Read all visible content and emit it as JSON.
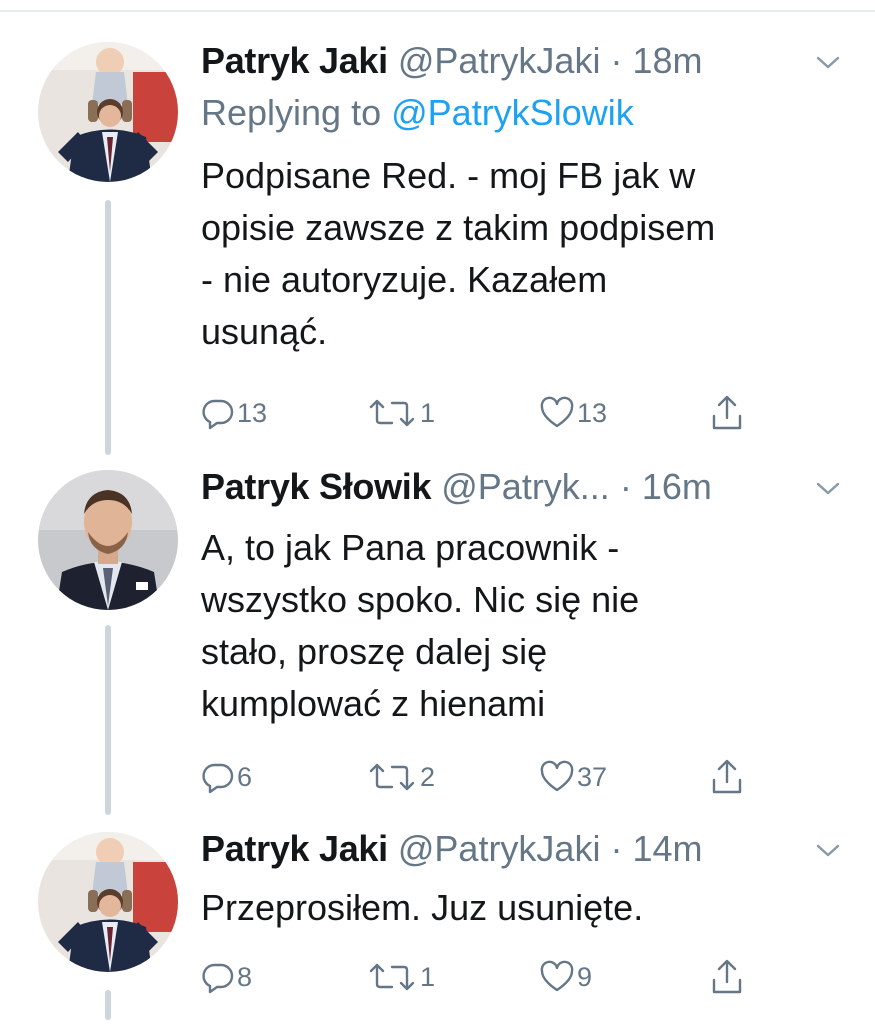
{
  "tweets": [
    {
      "name": "Patryk Jaki",
      "handle": "@PatrykJaki",
      "sep": " · ",
      "time": "18m",
      "reply_prefix": "Replying to ",
      "reply_to": "@PatrykSlowik",
      "text": "Podpisane Red. - moj FB jak w\nopisie zawsze z takim podpisem\n- nie autoryzuje. Kazałem\nusunąć.",
      "replies": "13",
      "retweets": "1",
      "likes": "13",
      "avatar": "child-on-shoulders-avatar"
    },
    {
      "name": "Patryk Słowik",
      "handle": "@Patryk...",
      "sep": " · ",
      "time": "16m",
      "text": "A, to jak Pana pracownik -\nwszystko spoko. Nic się nie\nstało, proszę dalej się\nkumplować z hienami",
      "replies": "6",
      "retweets": "2",
      "likes": "37",
      "avatar": "man-in-suit-avatar"
    },
    {
      "name": "Patryk Jaki",
      "handle": "@PatrykJaki",
      "sep": " · ",
      "time": "14m",
      "text": "Przeprosiłem. Juz usunięte.",
      "replies": "8",
      "retweets": "1",
      "likes": "9",
      "avatar": "child-on-shoulders-avatar"
    }
  ],
  "icons": {
    "reply": "reply-icon",
    "retweet": "retweet-icon",
    "like": "heart-icon",
    "share": "share-icon",
    "more": "chevron-down-icon"
  },
  "colors": {
    "text": "#14171a",
    "secondary": "#657786",
    "link": "#1da1f2",
    "thread_line": "#ccd6dd"
  }
}
